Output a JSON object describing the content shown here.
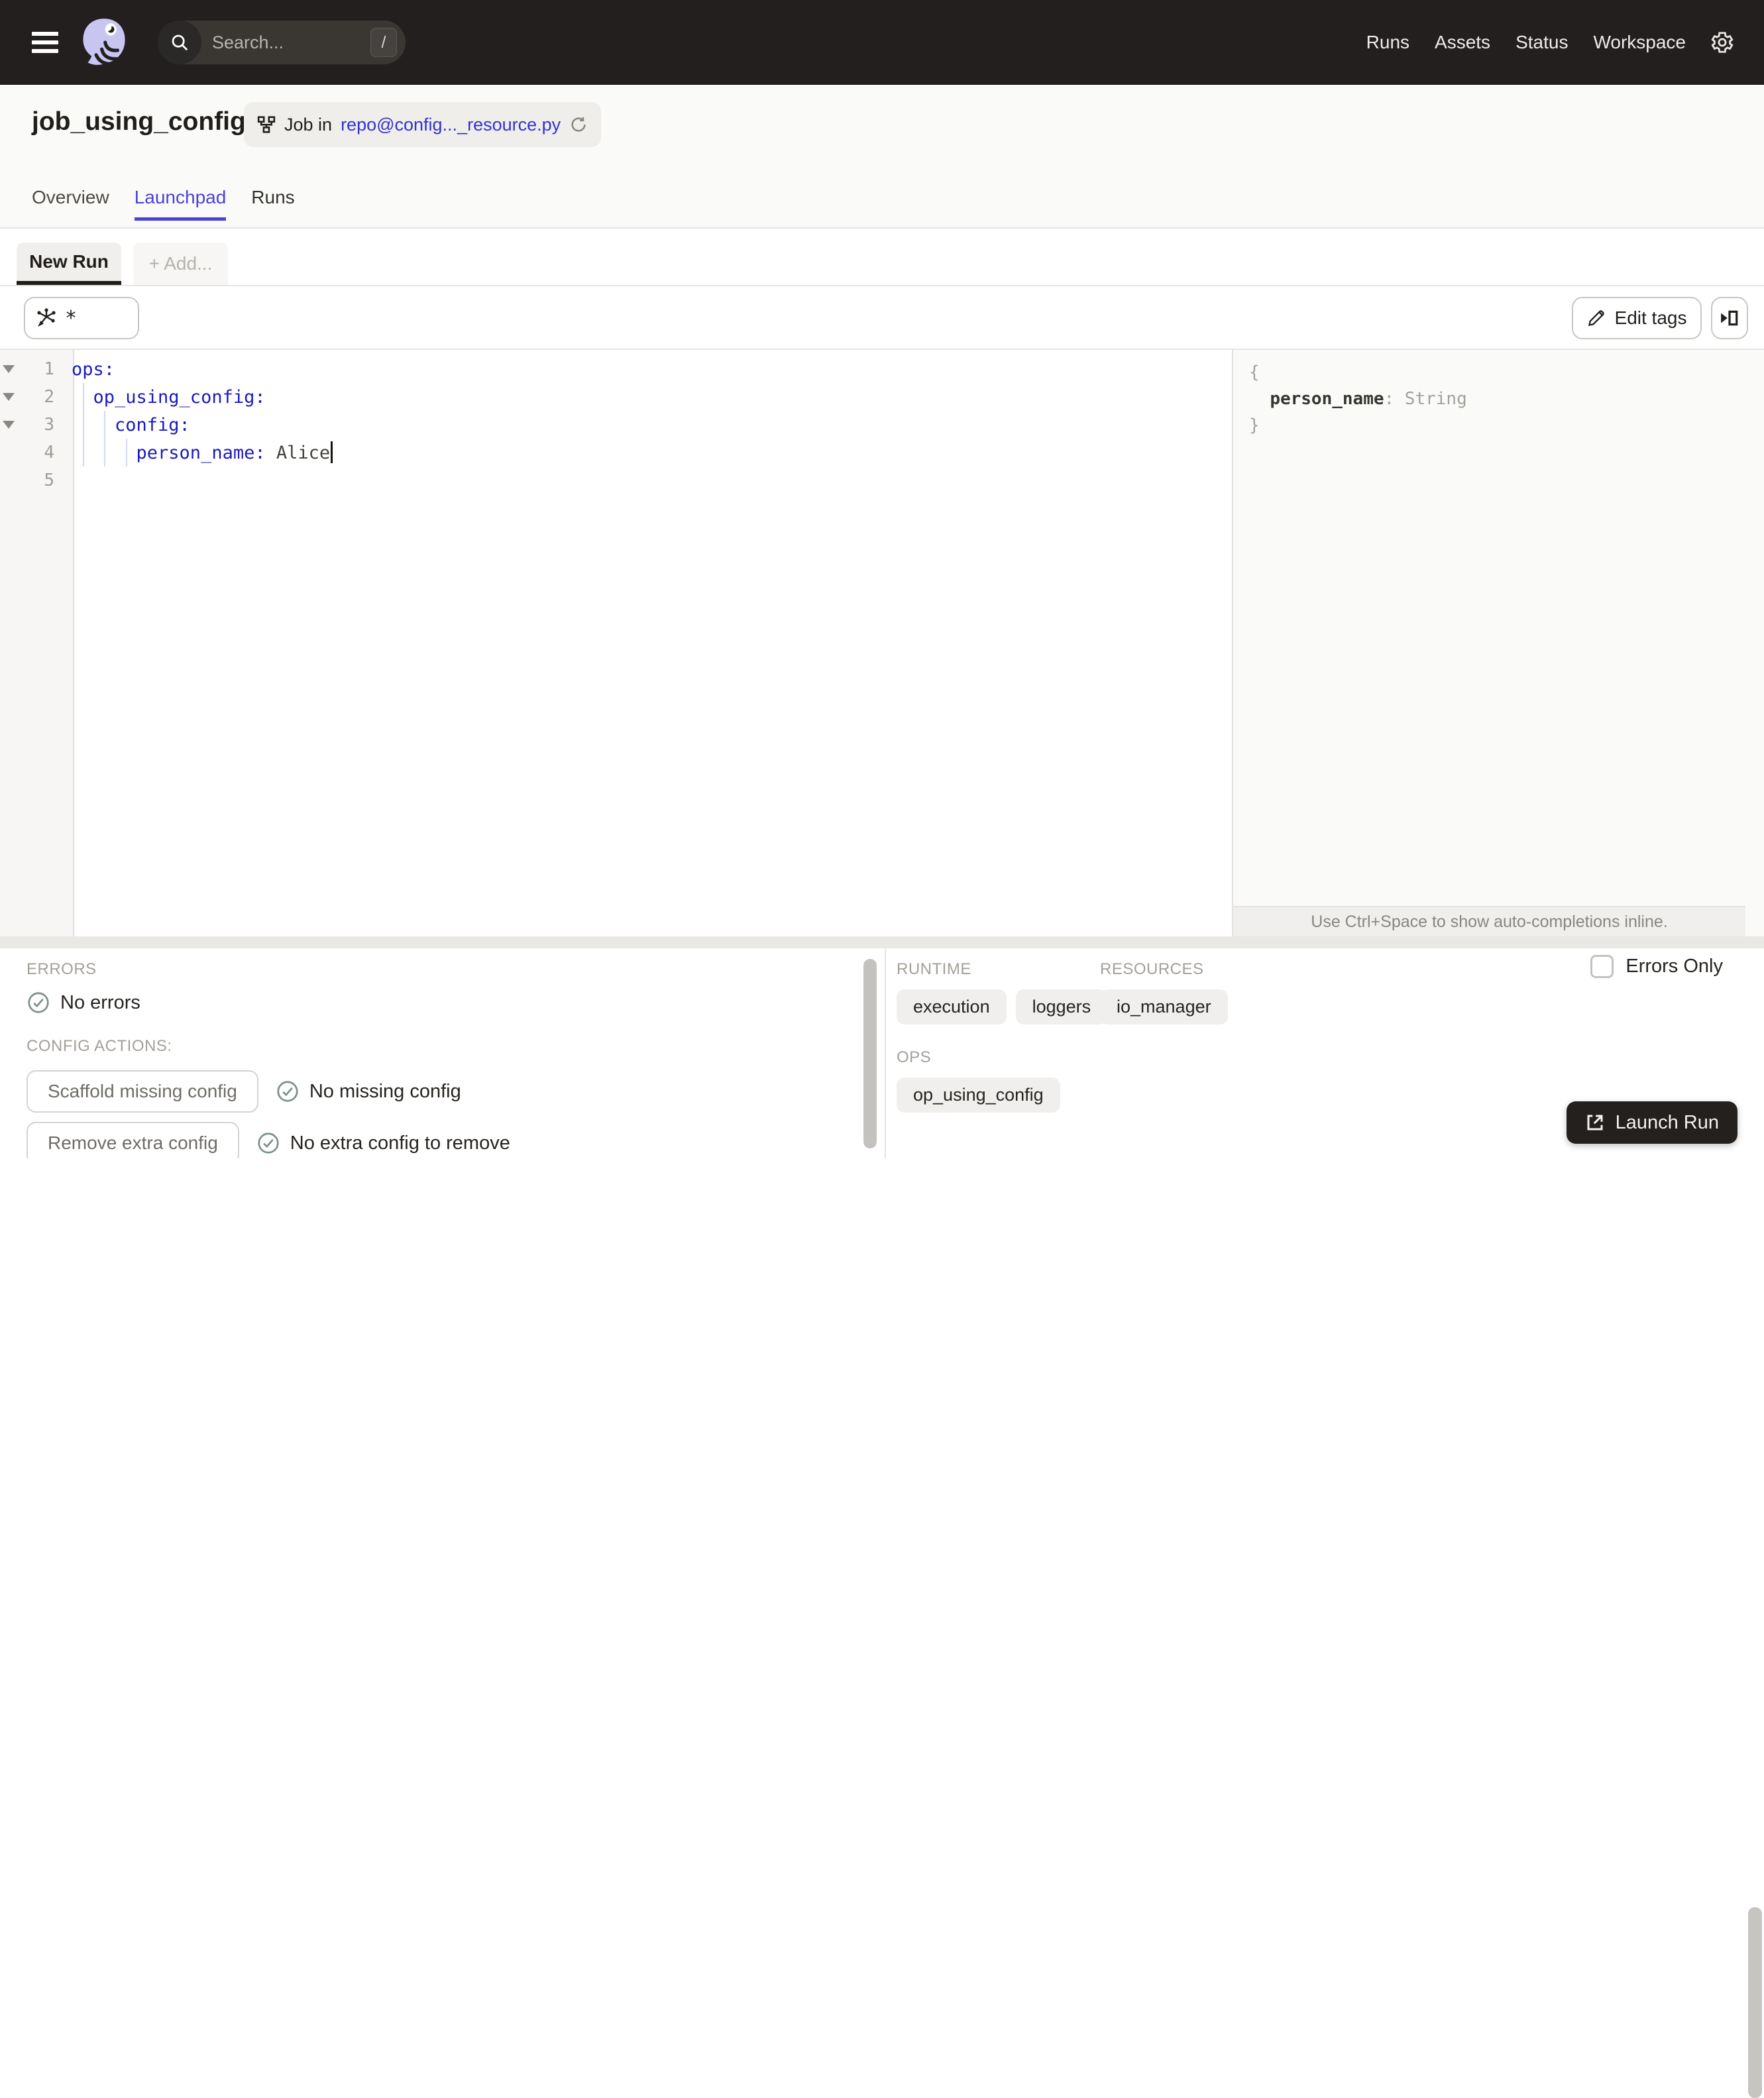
{
  "colors": {
    "navbar_bg": "#221F1E",
    "accent": "#4A42D8",
    "link": "#3531D4",
    "yaml_key": "#1B1ABF",
    "check_icon": "#7D9086",
    "dark_button": "#23201D"
  },
  "navbar": {
    "search_placeholder": "Search...",
    "search_shortcut": "/",
    "links": [
      "Runs",
      "Assets",
      "Status",
      "Workspace"
    ]
  },
  "header": {
    "title": "job_using_config",
    "badge": {
      "prefix": "Job in",
      "link": "repo@config..._resource.py"
    },
    "tabs": [
      {
        "label": "Overview"
      },
      {
        "label": "Launchpad"
      },
      {
        "label": "Runs"
      }
    ]
  },
  "launchpad": {
    "session_tabs": [
      {
        "label": "New Run"
      },
      {
        "label": "+ Add..."
      }
    ],
    "op_selector_value": "*",
    "edit_tags_label": "Edit tags"
  },
  "editor": {
    "lines": [
      {
        "num": "1",
        "key": "ops:",
        "value": ""
      },
      {
        "num": "2",
        "key": "  op_using_config:",
        "value": ""
      },
      {
        "num": "3",
        "key": "    config:",
        "value": ""
      },
      {
        "num": "4",
        "key": "      person_name:",
        "value": " Alice"
      },
      {
        "num": "5",
        "key": "",
        "value": ""
      }
    ],
    "schema": {
      "open": "{",
      "indent": "  ",
      "key": "person_name",
      "rest": ": String",
      "close": "}"
    },
    "footer_hint": "Use Ctrl+Space to show auto-completions inline."
  },
  "bottom": {
    "errors": {
      "label": "ERRORS",
      "status": "No errors"
    },
    "config_actions": {
      "label": "CONFIG ACTIONS:",
      "rows": [
        {
          "button": "Scaffold missing config",
          "status": "No missing config"
        },
        {
          "button": "Remove extra config",
          "status": "No extra config to remove"
        }
      ]
    },
    "runtime": {
      "label": "RUNTIME",
      "tags": [
        "execution",
        "loggers"
      ]
    },
    "resources": {
      "label": "RESOURCES",
      "tags": [
        "io_manager"
      ]
    },
    "ops": {
      "label": "OPS",
      "tags": [
        "op_using_config"
      ]
    },
    "errors_only_label": "Errors Only",
    "launch_button_label": "Launch Run"
  }
}
